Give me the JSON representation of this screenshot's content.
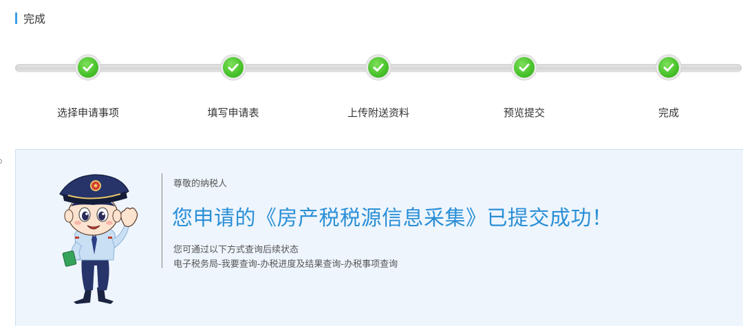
{
  "section": {
    "title": "完成"
  },
  "steps": [
    {
      "label": "选择申请事项",
      "status": "done"
    },
    {
      "label": "填写申请表",
      "status": "done"
    },
    {
      "label": "上传附送资料",
      "status": "done"
    },
    {
      "label": "预览提交",
      "status": "done"
    },
    {
      "label": "完成",
      "status": "done"
    }
  ],
  "result": {
    "greeting": "尊敬的纳税人",
    "headline": "您申请的《房产税税源信息采集》已提交成功！",
    "hint": "您可通过以下方式查询后续状态",
    "path": "电子税务局-我要查询-办税进度及结果查询-办税事项查询"
  },
  "colors": {
    "accent": "#2a8fd6",
    "title_bar": "#3a9ee8",
    "step_done": "#47c12a",
    "panel_bg": "#eef5fd"
  }
}
